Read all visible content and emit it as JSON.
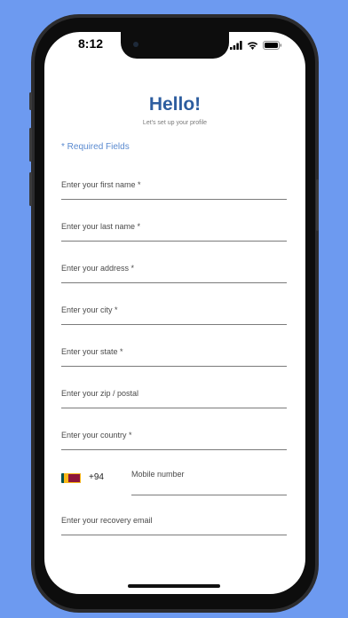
{
  "status_bar": {
    "time": "8:12",
    "icons": [
      "cellular-signal-icon",
      "wifi-icon",
      "battery-icon"
    ]
  },
  "header": {
    "title": "Hello!",
    "subtitle": "Let's set up your profile"
  },
  "form": {
    "required_note": "* Required Fields",
    "fields": [
      {
        "label": "Enter your first name *"
      },
      {
        "label": "Enter your last name *"
      },
      {
        "label": "Enter your address *"
      },
      {
        "label": "Enter your city *"
      },
      {
        "label": "Enter your state *"
      },
      {
        "label": "Enter your zip / postal"
      },
      {
        "label": "Enter your country *"
      }
    ],
    "phone": {
      "flag_icon": "sri-lanka-flag-icon",
      "country_code": "+94",
      "placeholder": "Mobile number"
    },
    "recovery_email": {
      "label": "Enter your recovery email"
    }
  },
  "colors": {
    "background": "#6d9af0",
    "title": "#2d5d9f",
    "accent": "#5a8ad0"
  }
}
